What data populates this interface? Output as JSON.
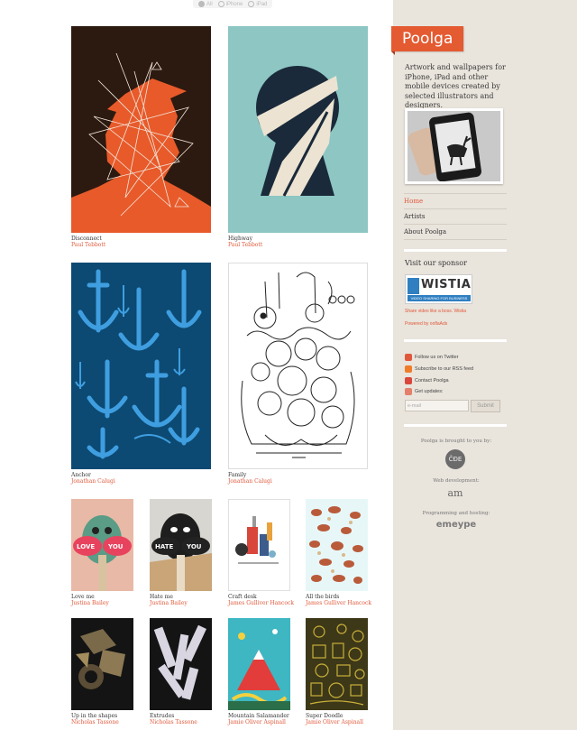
{
  "topbar": {
    "items": [
      "All",
      "iPhone",
      "iPad"
    ]
  },
  "gallery": [
    {
      "title": "Disconnect",
      "author": "Paul Tebbott"
    },
    {
      "title": "Highway",
      "author": "Paul Tebbott"
    },
    {
      "title": "Anchor",
      "author": "Jonathan Calugi"
    },
    {
      "title": "Family",
      "author": "Jonathan Calugi"
    },
    {
      "title": "Love me",
      "author": "Justina Bailey"
    },
    {
      "title": "Hate me",
      "author": "Justina Bailey"
    },
    {
      "title": "Craft desk",
      "author": "James Gulliver Hancock"
    },
    {
      "title": "All the birds",
      "author": "James Gulliver Hancock"
    },
    {
      "title": "Up in the shapes",
      "author": "Nicholas Tassone"
    },
    {
      "title": "Extrudes",
      "author": "Nicholas Tassone"
    },
    {
      "title": "Mountain Salamander",
      "author": "Jamie Oliver Aspinall"
    },
    {
      "title": "Super Doodle",
      "author": "Jamie Oliver Aspinall"
    }
  ],
  "art_text": {
    "love": "LOVE",
    "you": "YOU",
    "hate": "HATE"
  },
  "sidebar": {
    "logo": "Poolga",
    "tagline": "Artwork and wallpapers for iPhone, iPad and other mobile devices created by selected illustrators and designers.",
    "nav": [
      "Home",
      "Artists",
      "About Poolga"
    ],
    "sponsor_heading": "Visit our sponsor",
    "sponsor_logo": "WISTIA",
    "sponsor_sub": "VIDEO SHARING FOR BUSINESS",
    "sponsor_text": "Share video like a boss. Wistia",
    "powered": "Powered by ooflaAds",
    "social": [
      "Follow us on Twitter",
      "Subscribe to our RSS feed",
      "Contact Poolga",
      "Get updates:"
    ],
    "email_placeholder": "e-mail",
    "submit": "Submit",
    "brought_by": "Poolga is brought to you by:",
    "brought_logo": "ČĐE",
    "web_dev": "Web development:",
    "web_dev_logo": "am",
    "hosting": "Programming and hosting:",
    "hosting_logo": "emeype"
  },
  "colors": {
    "accent": "#e0583a",
    "logo_bg": "#e45a31",
    "sidebar_bg": "#e9e4dc"
  }
}
